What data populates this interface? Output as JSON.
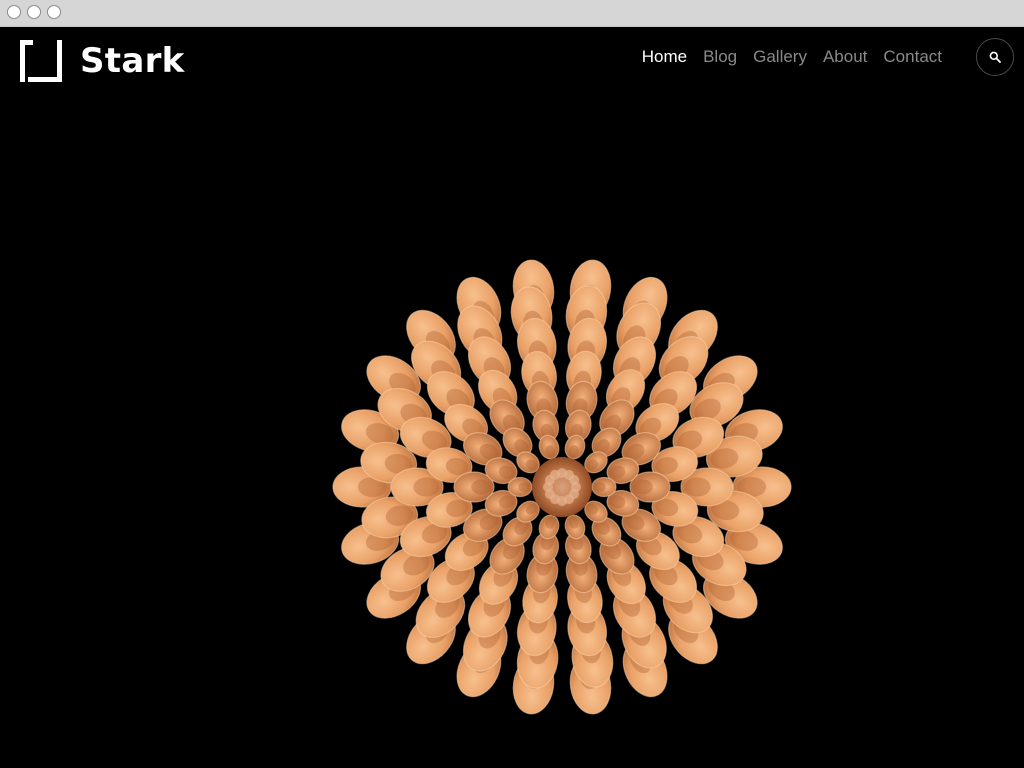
{
  "site": {
    "name": "Stark"
  },
  "nav": {
    "items": [
      {
        "label": "Home",
        "active": true
      },
      {
        "label": "Blog",
        "active": false
      },
      {
        "label": "Gallery",
        "active": false
      },
      {
        "label": "About",
        "active": false
      },
      {
        "label": "Contact",
        "active": false
      }
    ]
  },
  "icons": {
    "logo": "square-bracket-logo-icon",
    "search": "search-icon"
  },
  "colors": {
    "background": "#000000",
    "nav_active": "#ffffff",
    "nav_inactive": "#8a8a8a",
    "flower_petal": "#eaa06a",
    "flower_center": "#c9703f"
  }
}
